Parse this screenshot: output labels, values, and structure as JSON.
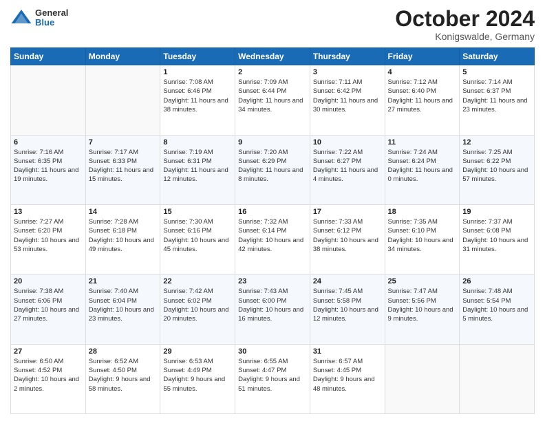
{
  "header": {
    "logo": {
      "general": "General",
      "blue": "Blue"
    },
    "title": "October 2024",
    "location": "Konigswalde, Germany"
  },
  "days_of_week": [
    "Sunday",
    "Monday",
    "Tuesday",
    "Wednesday",
    "Thursday",
    "Friday",
    "Saturday"
  ],
  "weeks": [
    [
      null,
      null,
      {
        "day": "1",
        "sunrise": "Sunrise: 7:08 AM",
        "sunset": "Sunset: 6:46 PM",
        "daylight": "Daylight: 11 hours and 38 minutes."
      },
      {
        "day": "2",
        "sunrise": "Sunrise: 7:09 AM",
        "sunset": "Sunset: 6:44 PM",
        "daylight": "Daylight: 11 hours and 34 minutes."
      },
      {
        "day": "3",
        "sunrise": "Sunrise: 7:11 AM",
        "sunset": "Sunset: 6:42 PM",
        "daylight": "Daylight: 11 hours and 30 minutes."
      },
      {
        "day": "4",
        "sunrise": "Sunrise: 7:12 AM",
        "sunset": "Sunset: 6:40 PM",
        "daylight": "Daylight: 11 hours and 27 minutes."
      },
      {
        "day": "5",
        "sunrise": "Sunrise: 7:14 AM",
        "sunset": "Sunset: 6:37 PM",
        "daylight": "Daylight: 11 hours and 23 minutes."
      }
    ],
    [
      {
        "day": "6",
        "sunrise": "Sunrise: 7:16 AM",
        "sunset": "Sunset: 6:35 PM",
        "daylight": "Daylight: 11 hours and 19 minutes."
      },
      {
        "day": "7",
        "sunrise": "Sunrise: 7:17 AM",
        "sunset": "Sunset: 6:33 PM",
        "daylight": "Daylight: 11 hours and 15 minutes."
      },
      {
        "day": "8",
        "sunrise": "Sunrise: 7:19 AM",
        "sunset": "Sunset: 6:31 PM",
        "daylight": "Daylight: 11 hours and 12 minutes."
      },
      {
        "day": "9",
        "sunrise": "Sunrise: 7:20 AM",
        "sunset": "Sunset: 6:29 PM",
        "daylight": "Daylight: 11 hours and 8 minutes."
      },
      {
        "day": "10",
        "sunrise": "Sunrise: 7:22 AM",
        "sunset": "Sunset: 6:27 PM",
        "daylight": "Daylight: 11 hours and 4 minutes."
      },
      {
        "day": "11",
        "sunrise": "Sunrise: 7:24 AM",
        "sunset": "Sunset: 6:24 PM",
        "daylight": "Daylight: 11 hours and 0 minutes."
      },
      {
        "day": "12",
        "sunrise": "Sunrise: 7:25 AM",
        "sunset": "Sunset: 6:22 PM",
        "daylight": "Daylight: 10 hours and 57 minutes."
      }
    ],
    [
      {
        "day": "13",
        "sunrise": "Sunrise: 7:27 AM",
        "sunset": "Sunset: 6:20 PM",
        "daylight": "Daylight: 10 hours and 53 minutes."
      },
      {
        "day": "14",
        "sunrise": "Sunrise: 7:28 AM",
        "sunset": "Sunset: 6:18 PM",
        "daylight": "Daylight: 10 hours and 49 minutes."
      },
      {
        "day": "15",
        "sunrise": "Sunrise: 7:30 AM",
        "sunset": "Sunset: 6:16 PM",
        "daylight": "Daylight: 10 hours and 45 minutes."
      },
      {
        "day": "16",
        "sunrise": "Sunrise: 7:32 AM",
        "sunset": "Sunset: 6:14 PM",
        "daylight": "Daylight: 10 hours and 42 minutes."
      },
      {
        "day": "17",
        "sunrise": "Sunrise: 7:33 AM",
        "sunset": "Sunset: 6:12 PM",
        "daylight": "Daylight: 10 hours and 38 minutes."
      },
      {
        "day": "18",
        "sunrise": "Sunrise: 7:35 AM",
        "sunset": "Sunset: 6:10 PM",
        "daylight": "Daylight: 10 hours and 34 minutes."
      },
      {
        "day": "19",
        "sunrise": "Sunrise: 7:37 AM",
        "sunset": "Sunset: 6:08 PM",
        "daylight": "Daylight: 10 hours and 31 minutes."
      }
    ],
    [
      {
        "day": "20",
        "sunrise": "Sunrise: 7:38 AM",
        "sunset": "Sunset: 6:06 PM",
        "daylight": "Daylight: 10 hours and 27 minutes."
      },
      {
        "day": "21",
        "sunrise": "Sunrise: 7:40 AM",
        "sunset": "Sunset: 6:04 PM",
        "daylight": "Daylight: 10 hours and 23 minutes."
      },
      {
        "day": "22",
        "sunrise": "Sunrise: 7:42 AM",
        "sunset": "Sunset: 6:02 PM",
        "daylight": "Daylight: 10 hours and 20 minutes."
      },
      {
        "day": "23",
        "sunrise": "Sunrise: 7:43 AM",
        "sunset": "Sunset: 6:00 PM",
        "daylight": "Daylight: 10 hours and 16 minutes."
      },
      {
        "day": "24",
        "sunrise": "Sunrise: 7:45 AM",
        "sunset": "Sunset: 5:58 PM",
        "daylight": "Daylight: 10 hours and 12 minutes."
      },
      {
        "day": "25",
        "sunrise": "Sunrise: 7:47 AM",
        "sunset": "Sunset: 5:56 PM",
        "daylight": "Daylight: 10 hours and 9 minutes."
      },
      {
        "day": "26",
        "sunrise": "Sunrise: 7:48 AM",
        "sunset": "Sunset: 5:54 PM",
        "daylight": "Daylight: 10 hours and 5 minutes."
      }
    ],
    [
      {
        "day": "27",
        "sunrise": "Sunrise: 6:50 AM",
        "sunset": "Sunset: 4:52 PM",
        "daylight": "Daylight: 10 hours and 2 minutes."
      },
      {
        "day": "28",
        "sunrise": "Sunrise: 6:52 AM",
        "sunset": "Sunset: 4:50 PM",
        "daylight": "Daylight: 9 hours and 58 minutes."
      },
      {
        "day": "29",
        "sunrise": "Sunrise: 6:53 AM",
        "sunset": "Sunset: 4:49 PM",
        "daylight": "Daylight: 9 hours and 55 minutes."
      },
      {
        "day": "30",
        "sunrise": "Sunrise: 6:55 AM",
        "sunset": "Sunset: 4:47 PM",
        "daylight": "Daylight: 9 hours and 51 minutes."
      },
      {
        "day": "31",
        "sunrise": "Sunrise: 6:57 AM",
        "sunset": "Sunset: 4:45 PM",
        "daylight": "Daylight: 9 hours and 48 minutes."
      },
      null,
      null
    ]
  ]
}
